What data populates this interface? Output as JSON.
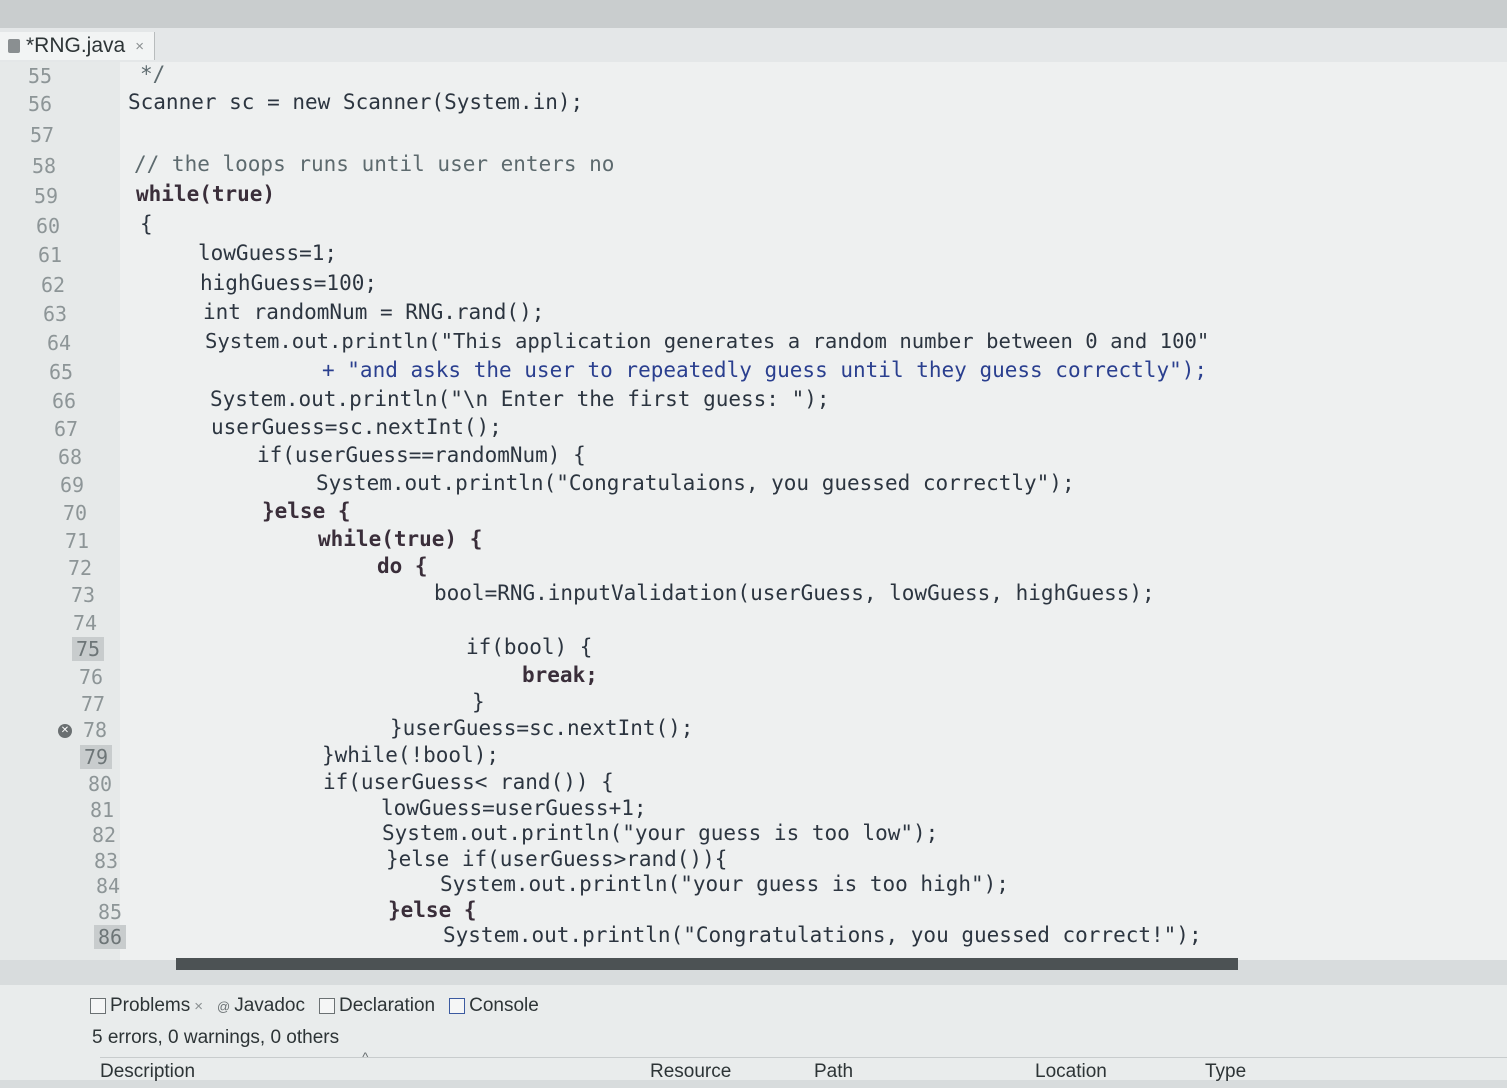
{
  "editor_tab": {
    "title": "*RNG.java",
    "close": "×",
    "icon": "java-file-icon"
  },
  "lines": [
    {
      "n": "55",
      "t": "*/"
    },
    {
      "n": "56",
      "t": "Scanner sc = new Scanner(System.in);"
    },
    {
      "n": "57",
      "t": ""
    },
    {
      "n": "58",
      "t": "// the loops runs until user enters no"
    },
    {
      "n": "59",
      "t": "while(true)"
    },
    {
      "n": "60",
      "t": "{"
    },
    {
      "n": "61",
      "t": "lowGuess=1;"
    },
    {
      "n": "62",
      "t": "highGuess=100;"
    },
    {
      "n": "63",
      "t": "int randomNum = RNG.rand();"
    },
    {
      "n": "64",
      "t": "System.out.println(\"This application generates a random number between 0 and 100\""
    },
    {
      "n": "65",
      "t": "+ \"and asks the user to repeatedly guess until they guess correctly\");"
    },
    {
      "n": "66",
      "t": "System.out.println(\"\\n Enter the first guess: \");"
    },
    {
      "n": "67",
      "t": "userGuess=sc.nextInt();"
    },
    {
      "n": "68",
      "t": "if(userGuess==randomNum) {"
    },
    {
      "n": "69",
      "t": "System.out.println(\"Congratulaions, you guessed correctly\");"
    },
    {
      "n": "70",
      "t": "}else {"
    },
    {
      "n": "71",
      "t": "while(true) {"
    },
    {
      "n": "72",
      "t": "do {"
    },
    {
      "n": "73",
      "t": "bool=RNG.inputValidation(userGuess, lowGuess, highGuess);"
    },
    {
      "n": "74",
      "t": ""
    },
    {
      "n": "75",
      "t": "if(bool) {"
    },
    {
      "n": "76",
      "t": "break;"
    },
    {
      "n": "77",
      "t": "}"
    },
    {
      "n": "78",
      "t": "}userGuess=sc.nextInt();"
    },
    {
      "n": "79",
      "t": "}while(!bool);"
    },
    {
      "n": "80",
      "t": "if(userGuess< rand()) {"
    },
    {
      "n": "81",
      "t": "lowGuess=userGuess+1;"
    },
    {
      "n": "82",
      "t": "System.out.println(\"your guess is too low\");"
    },
    {
      "n": "83",
      "t": "}else if(userGuess>rand()){"
    },
    {
      "n": "84",
      "t": "System.out.println(\"your guess is too high\");"
    },
    {
      "n": "85",
      "t": "}else {"
    },
    {
      "n": "86",
      "t": "System.out.println(\"Congratulations, you guessed correct!\");"
    }
  ],
  "panel": {
    "tabs": [
      {
        "label": "Problems",
        "close": "×",
        "icon": "problems-icon"
      },
      {
        "label": "Javadoc",
        "icon": "javadoc-icon"
      },
      {
        "label": "Declaration",
        "icon": "declaration-icon"
      },
      {
        "label": "Console",
        "icon": "console-icon"
      }
    ],
    "summary": "5 errors, 0 warnings, 0 others",
    "columns": [
      "Description",
      "Resource",
      "Path",
      "Location",
      "Type"
    ]
  }
}
